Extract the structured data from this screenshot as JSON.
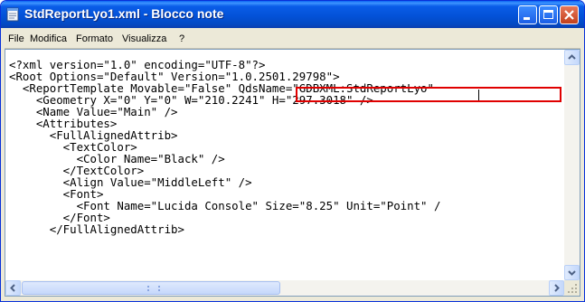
{
  "window": {
    "title": "StdReportLyo1.xml - Blocco note"
  },
  "menu": {
    "items": [
      "File",
      "Modifica",
      "Formato",
      "Visualizza",
      "?"
    ]
  },
  "editor": {
    "lines": [
      "<?xml version=\"1.0\" encoding=\"UTF-8\"?>",
      "<Root Options=\"Default\" Version=\"1.0.2501.29798\">",
      "  <ReportTemplate Movable=\"False\" QdsName=\"GDBXML:StdReportLyo\"",
      "    <Geometry X=\"0\" Y=\"0\" W=\"210.2241\" H=\"297.3018\" />",
      "    <Name Value=\"Main\" />",
      "    <Attributes>",
      "      <FullAlignedAttrib>",
      "        <TextColor>",
      "          <Color Name=\"Black\" />",
      "        </TextColor>",
      "        <Align Value=\"MiddleLeft\" />",
      "        <Font>",
      "          <Font Name=\"Lucida Console\" Size=\"8.25\" Unit=\"Point\" /",
      "        </Font>",
      "      </FullAlignedAttrib>"
    ]
  },
  "colors": {
    "titlebar": "#0a5de8",
    "highlight_border": "#e00000",
    "close_button": "#c2401c"
  },
  "icons": {
    "app": "notepad-icon",
    "minimize": "minimize-icon",
    "maximize": "maximize-icon",
    "close": "close-icon"
  }
}
